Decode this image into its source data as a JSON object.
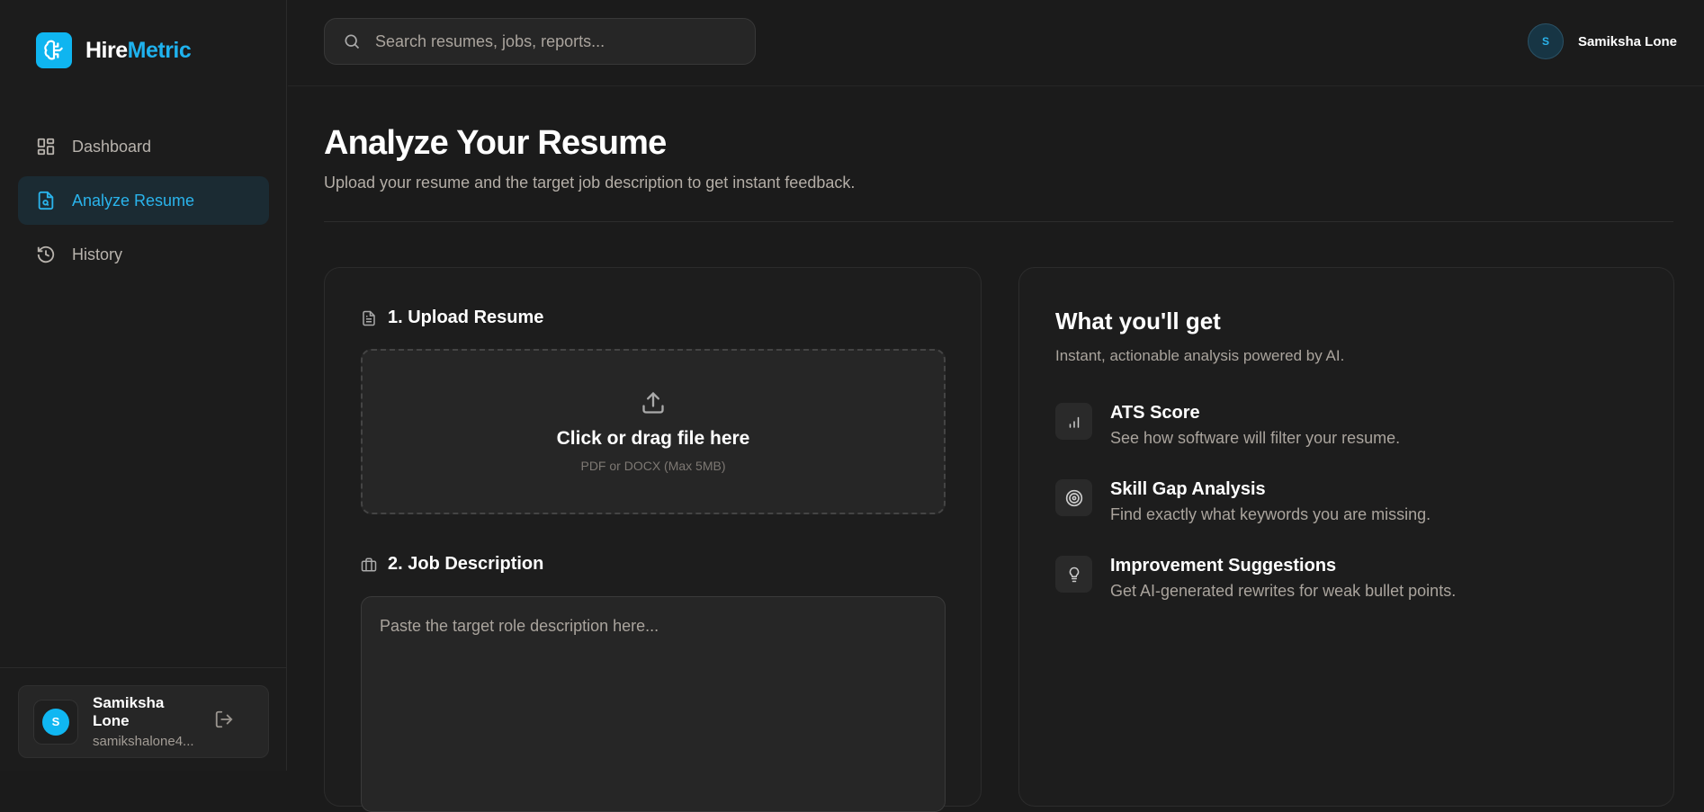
{
  "brand": {
    "part1": "Hire",
    "part2": "Metric"
  },
  "nav": [
    {
      "label": "Dashboard",
      "icon": "dashboard-icon"
    },
    {
      "label": "Analyze Resume",
      "icon": "file-search-icon",
      "active": true
    },
    {
      "label": "History",
      "icon": "history-icon"
    }
  ],
  "user": {
    "initial": "S",
    "name": "Samiksha Lone",
    "email": "samikshalone4..."
  },
  "header": {
    "search_placeholder": "Search resumes, jobs, reports...",
    "user_initial": "S",
    "user_name": "Samiksha Lone"
  },
  "page": {
    "title": "Analyze Your Resume",
    "subtitle": "Upload your resume and the target job description to get instant feedback."
  },
  "upload": {
    "label": "1. Upload Resume",
    "drop_main": "Click or drag file here",
    "drop_sub": "PDF or DOCX (Max 5MB)"
  },
  "job": {
    "label": "2. Job Description",
    "placeholder": "Paste the target role description here..."
  },
  "info": {
    "title": "What you'll get",
    "subtitle": "Instant, actionable analysis powered by AI.",
    "features": [
      {
        "title": "ATS Score",
        "desc": "See how software will filter your resume."
      },
      {
        "title": "Skill Gap Analysis",
        "desc": "Find exactly what keywords you are missing."
      },
      {
        "title": "Improvement Suggestions",
        "desc": "Get AI-generated rewrites for weak bullet points."
      }
    ]
  },
  "colors": {
    "accent": "#0fb5f0",
    "bg": "#1b1b1b"
  }
}
